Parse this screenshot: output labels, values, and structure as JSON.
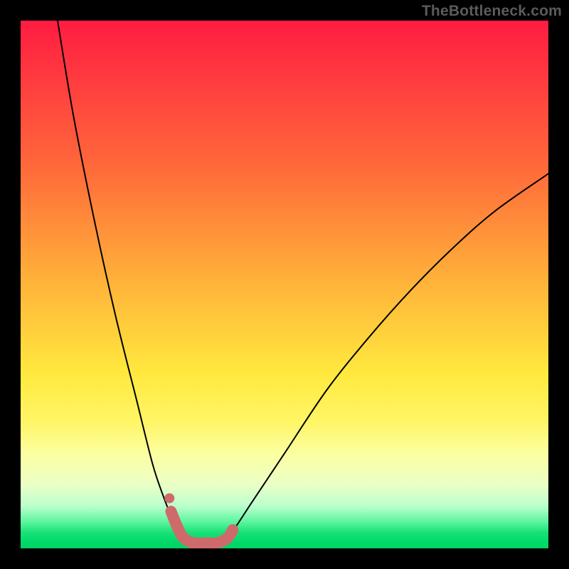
{
  "watermark": "TheBottleneck.com",
  "chart_data": {
    "type": "line",
    "title": "",
    "xlabel": "",
    "ylabel": "",
    "xlim": [
      0,
      100
    ],
    "ylim": [
      0,
      100
    ],
    "grid": false,
    "legend": false,
    "gradient_colors_top_to_bottom": [
      "#ff1c42",
      "#ffb43a",
      "#ffe93e",
      "#00d264"
    ],
    "series": [
      {
        "name": "bottleneck-curve",
        "color": "#000000",
        "x": [
          7,
          10,
          14,
          18,
          22,
          25,
          27,
          29,
          30.5,
          32,
          34,
          36,
          38,
          40,
          44,
          50,
          58,
          66,
          74,
          82,
          90,
          100
        ],
        "values": [
          100,
          82,
          62,
          44,
          28,
          16,
          10,
          5,
          2.5,
          1,
          0,
          0,
          1,
          3,
          9,
          18,
          30,
          40,
          49,
          57,
          64,
          71
        ]
      },
      {
        "name": "bottom-marker-strip",
        "color": "#cf6a6c",
        "x": [
          28.5,
          29.5,
          30.5,
          31.5,
          33,
          35,
          37,
          38.5,
          39.5,
          40.2
        ],
        "values": [
          7.0,
          4.5,
          2.5,
          1.5,
          1,
          1,
          1,
          1.5,
          2.3,
          3.5
        ]
      },
      {
        "name": "upper-marker-dot",
        "color": "#cf6a6c",
        "x": [
          28.2
        ],
        "values": [
          9.5
        ]
      }
    ]
  }
}
